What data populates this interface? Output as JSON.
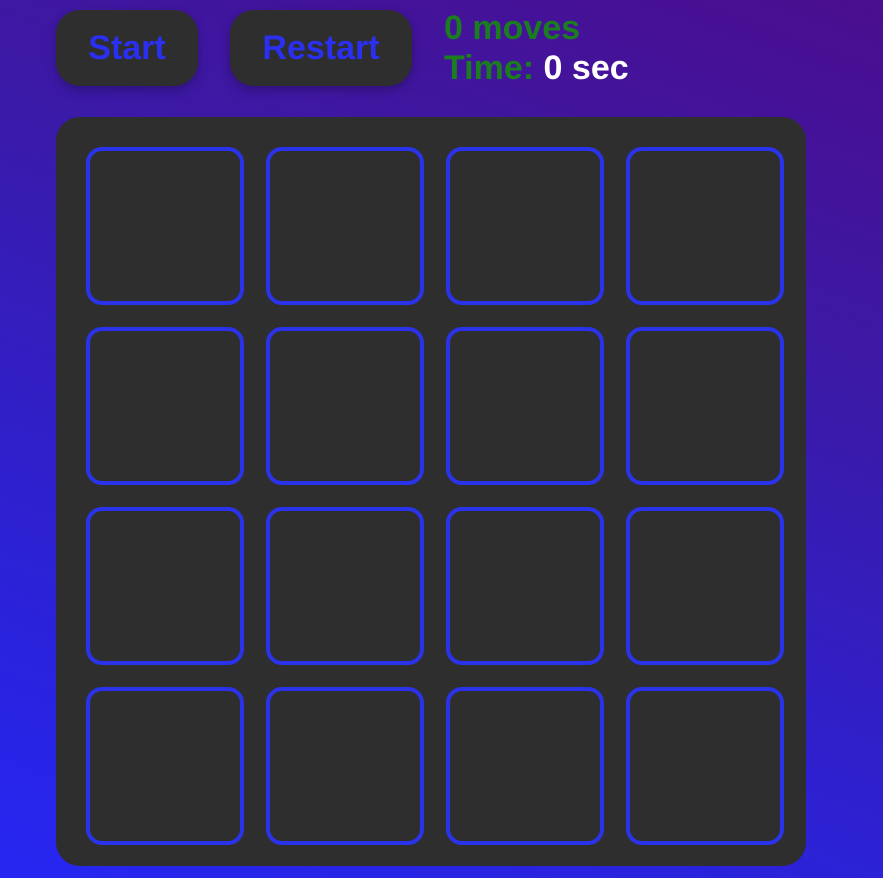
{
  "controls": {
    "start_label": "Start",
    "restart_label": "Restart"
  },
  "stats": {
    "moves_value": "0",
    "moves_label": "moves",
    "time_label": "Time:",
    "time_value": "0",
    "time_unit": "sec"
  },
  "board": {
    "rows": 4,
    "cols": 4,
    "cards": [
      {
        "face": "hidden"
      },
      {
        "face": "hidden"
      },
      {
        "face": "hidden"
      },
      {
        "face": "hidden"
      },
      {
        "face": "hidden"
      },
      {
        "face": "hidden"
      },
      {
        "face": "hidden"
      },
      {
        "face": "hidden"
      },
      {
        "face": "hidden"
      },
      {
        "face": "hidden"
      },
      {
        "face": "hidden"
      },
      {
        "face": "hidden"
      },
      {
        "face": "hidden"
      },
      {
        "face": "hidden"
      },
      {
        "face": "hidden"
      },
      {
        "face": "hidden"
      }
    ]
  },
  "colors": {
    "button_text": "#2a2ff0",
    "card_border": "#2b33ea",
    "panel_bg": "#2e2e2e",
    "stat_label": "#1a7d1f",
    "time_value": "#ffffff"
  }
}
